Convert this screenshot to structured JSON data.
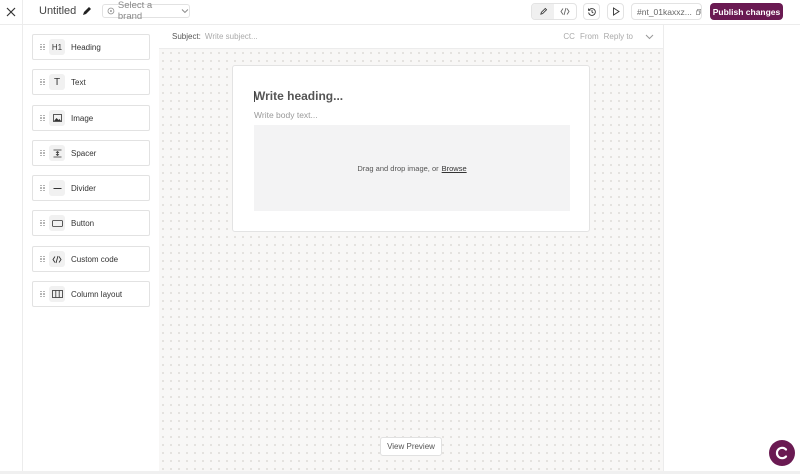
{
  "header": {
    "title": "Untitled",
    "brand_placeholder": "Select a brand",
    "id_tag": "#nt_01kaxxz...",
    "publish_label": "Publish changes"
  },
  "sidebar": {
    "items": [
      {
        "label": "Heading",
        "icon": "H1",
        "icon_name": "heading-icon"
      },
      {
        "label": "Text",
        "icon": "T",
        "icon_name": "text-icon"
      },
      {
        "label": "Image",
        "icon_name": "image-icon"
      },
      {
        "label": "Spacer",
        "icon_name": "spacer-icon"
      },
      {
        "label": "Divider",
        "icon_name": "divider-icon"
      },
      {
        "label": "Button",
        "icon_name": "button-icon"
      },
      {
        "label": "Custom code",
        "icon_name": "code-icon"
      },
      {
        "label": "Column layout",
        "icon_name": "columns-icon"
      }
    ]
  },
  "editor": {
    "subject_label": "Subject:",
    "subject_placeholder": "Write subject...",
    "cc_label": "CC",
    "from_label": "From",
    "reply_label": "Reply to",
    "heading_placeholder": "Write heading...",
    "body_placeholder": "Write body text...",
    "drop_text": "Drag and drop image, or",
    "browse_label": "Browse",
    "preview_label": "View Preview"
  },
  "colors": {
    "brand": "#6a1a52",
    "canvas_bg": "#f8f7f6"
  }
}
